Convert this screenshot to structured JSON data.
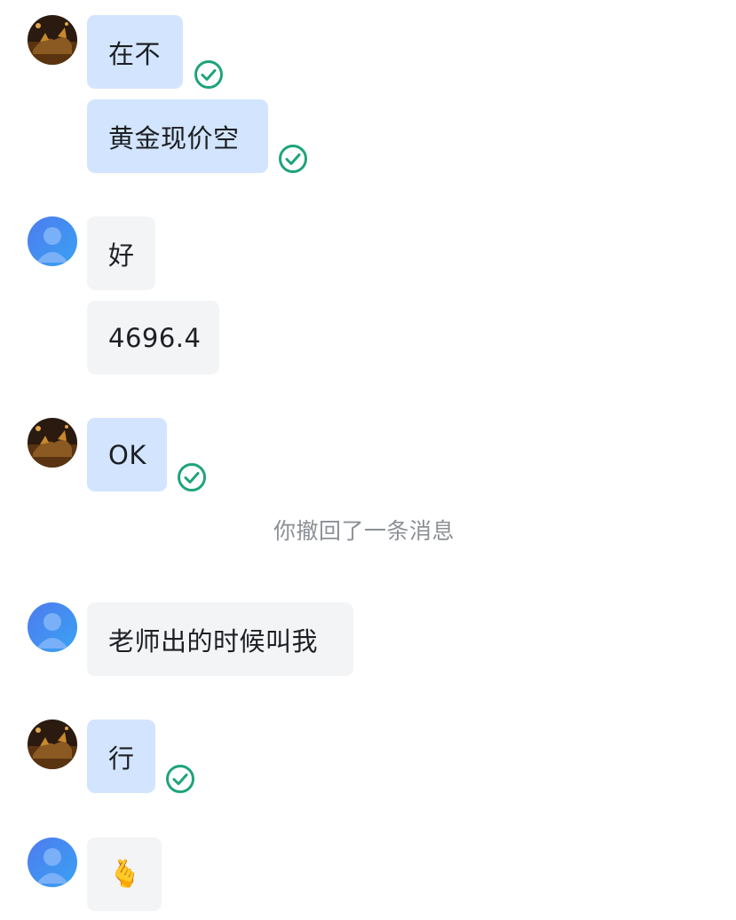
{
  "palette": {
    "my_bubble": "#d3e5fe",
    "their_bubble": "#f3f4f6",
    "read_check": "#1ea37c",
    "system_text": "#8c9096"
  },
  "icons": {
    "my_avatar": "bull-avatar-icon",
    "their_avatar": "default-user-avatar-icon",
    "read_receipt": "check-circle-icon"
  },
  "messages": [
    {
      "sender": "me",
      "text": "在不",
      "read": true
    },
    {
      "sender": "me",
      "text": "黄金现价空",
      "read": true
    },
    {
      "sender": "other",
      "text": "好"
    },
    {
      "sender": "other",
      "text": "4696.4"
    },
    {
      "sender": "me",
      "text": "OK",
      "read": true
    },
    {
      "sender": "system",
      "text": "你撤回了一条消息"
    },
    {
      "sender": "other",
      "text": "老师出的时候叫我"
    },
    {
      "sender": "me",
      "text": "行",
      "read": true
    },
    {
      "sender": "other",
      "text": "🫰"
    }
  ]
}
